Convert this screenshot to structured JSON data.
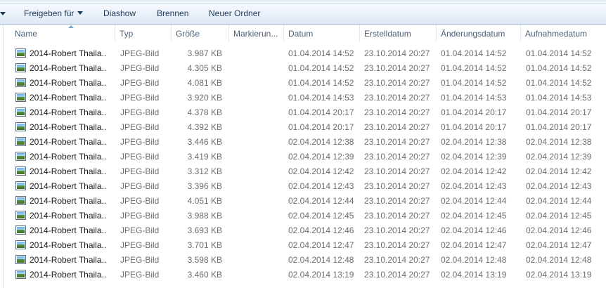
{
  "toolbar": {
    "share_label": "Freigeben für",
    "slideshow_label": "Diashow",
    "burn_label": "Brennen",
    "new_folder_label": "Neuer Ordner"
  },
  "columns": {
    "name": "Name",
    "type": "Typ",
    "size": "Größe",
    "tags": "Markierun...",
    "date": "Datum",
    "created": "Erstelldatum",
    "modified": "Änderungsdatum",
    "taken": "Aufnahmedatum"
  },
  "icons": {
    "file": "jpeg-image-icon",
    "sort": "sort-ascending-icon",
    "dropdown": "chevron-down-icon"
  },
  "colors": {
    "toolbar_bg": "#e9f0f9",
    "text": "#1e395b",
    "header_text": "#4c607a"
  },
  "files": [
    {
      "name": "2014-Robert Thaila...",
      "type": "JPEG-Bild",
      "size": "3.987 KB",
      "date": "01.04.2014 14:52",
      "created": "23.10.2014 20:27",
      "modified": "01.04.2014 14:52",
      "taken": "01.04.2014 14:52"
    },
    {
      "name": "2014-Robert Thaila...",
      "type": "JPEG-Bild",
      "size": "4.305 KB",
      "date": "01.04.2014 14:52",
      "created": "23.10.2014 20:27",
      "modified": "01.04.2014 14:52",
      "taken": "01.04.2014 14:52"
    },
    {
      "name": "2014-Robert Thaila...",
      "type": "JPEG-Bild",
      "size": "4.081 KB",
      "date": "01.04.2014 14:52",
      "created": "23.10.2014 20:27",
      "modified": "01.04.2014 14:52",
      "taken": "01.04.2014 14:52"
    },
    {
      "name": "2014-Robert Thaila...",
      "type": "JPEG-Bild",
      "size": "3.920 KB",
      "date": "01.04.2014 14:53",
      "created": "23.10.2014 20:27",
      "modified": "01.04.2014 14:53",
      "taken": "01.04.2014 14:53"
    },
    {
      "name": "2014-Robert Thaila...",
      "type": "JPEG-Bild",
      "size": "4.378 KB",
      "date": "01.04.2014 20:17",
      "created": "23.10.2014 20:27",
      "modified": "01.04.2014 20:17",
      "taken": "01.04.2014 20:17"
    },
    {
      "name": "2014-Robert Thaila...",
      "type": "JPEG-Bild",
      "size": "4.392 KB",
      "date": "01.04.2014 20:17",
      "created": "23.10.2014 20:27",
      "modified": "01.04.2014 20:17",
      "taken": "01.04.2014 20:17"
    },
    {
      "name": "2014-Robert Thaila...",
      "type": "JPEG-Bild",
      "size": "3.446 KB",
      "date": "02.04.2014 12:38",
      "created": "23.10.2014 20:27",
      "modified": "02.04.2014 12:38",
      "taken": "02.04.2014 12:38"
    },
    {
      "name": "2014-Robert Thaila...",
      "type": "JPEG-Bild",
      "size": "3.419 KB",
      "date": "02.04.2014 12:39",
      "created": "23.10.2014 20:27",
      "modified": "02.04.2014 12:39",
      "taken": "02.04.2014 12:39"
    },
    {
      "name": "2014-Robert Thaila...",
      "type": "JPEG-Bild",
      "size": "3.312 KB",
      "date": "02.04.2014 12:42",
      "created": "23.10.2014 20:27",
      "modified": "02.04.2014 12:42",
      "taken": "02.04.2014 12:42"
    },
    {
      "name": "2014-Robert Thaila...",
      "type": "JPEG-Bild",
      "size": "3.396 KB",
      "date": "02.04.2014 12:43",
      "created": "23.10.2014 20:27",
      "modified": "02.04.2014 12:43",
      "taken": "02.04.2014 12:43"
    },
    {
      "name": "2014-Robert Thaila...",
      "type": "JPEG-Bild",
      "size": "4.051 KB",
      "date": "02.04.2014 12:44",
      "created": "23.10.2014 20:27",
      "modified": "02.04.2014 12:44",
      "taken": "02.04.2014 12:44"
    },
    {
      "name": "2014-Robert Thaila...",
      "type": "JPEG-Bild",
      "size": "3.988 KB",
      "date": "02.04.2014 12:45",
      "created": "23.10.2014 20:27",
      "modified": "02.04.2014 12:45",
      "taken": "02.04.2014 12:45"
    },
    {
      "name": "2014-Robert Thaila...",
      "type": "JPEG-Bild",
      "size": "3.693 KB",
      "date": "02.04.2014 12:46",
      "created": "23.10.2014 20:27",
      "modified": "02.04.2014 12:46",
      "taken": "02.04.2014 12:46"
    },
    {
      "name": "2014-Robert Thaila...",
      "type": "JPEG-Bild",
      "size": "3.701 KB",
      "date": "02.04.2014 12:47",
      "created": "23.10.2014 20:27",
      "modified": "02.04.2014 12:47",
      "taken": "02.04.2014 12:47"
    },
    {
      "name": "2014-Robert Thaila...",
      "type": "JPEG-Bild",
      "size": "3.598 KB",
      "date": "02.04.2014 12:48",
      "created": "23.10.2014 20:27",
      "modified": "02.04.2014 12:48",
      "taken": "02.04.2014 12:48"
    },
    {
      "name": "2014-Robert Thaila...",
      "type": "JPEG-Bild",
      "size": "3.460 KB",
      "date": "02.04.2014 13:19",
      "created": "23.10.2014 20:27",
      "modified": "02.04.2014 13:19",
      "taken": "02.04.2014 13:19"
    }
  ]
}
